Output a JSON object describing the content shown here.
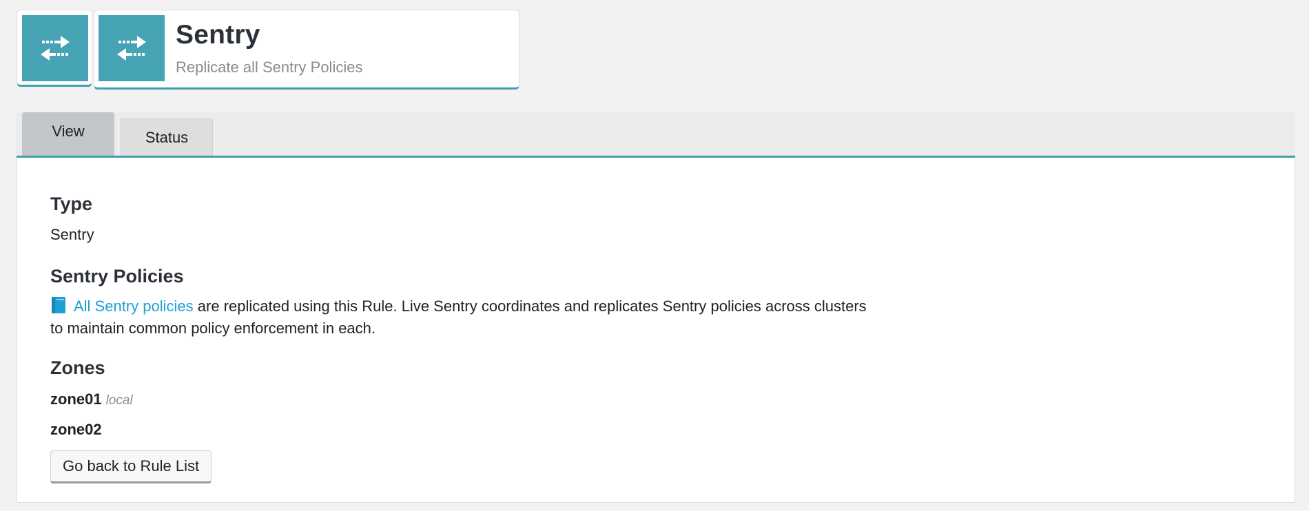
{
  "header": {
    "mini_icon": "transfer-arrows-icon",
    "icon": "transfer-arrows-icon",
    "title": "Sentry",
    "subtitle": "Replicate all Sentry Policies"
  },
  "tabs": [
    {
      "label": "View",
      "active": true
    },
    {
      "label": "Status",
      "active": false
    }
  ],
  "details": {
    "type_heading": "Type",
    "type_value": "Sentry",
    "policies_heading": "Sentry Policies",
    "policies_icon": "book-icon",
    "policies_link": "All Sentry policies",
    "policies_text": " are replicated using this Rule. Live Sentry coordinates and replicates Sentry policies across clusters to maintain common policy enforcement in each.",
    "zones_heading": "Zones",
    "zones": [
      {
        "name": "zone01",
        "tag": "local"
      },
      {
        "name": "zone02",
        "tag": ""
      }
    ]
  },
  "back_button_label": "Go back to Rule List",
  "colors": {
    "accent": "#45a3b3",
    "link": "#1f9fd4",
    "background": "#f2f2f2"
  }
}
